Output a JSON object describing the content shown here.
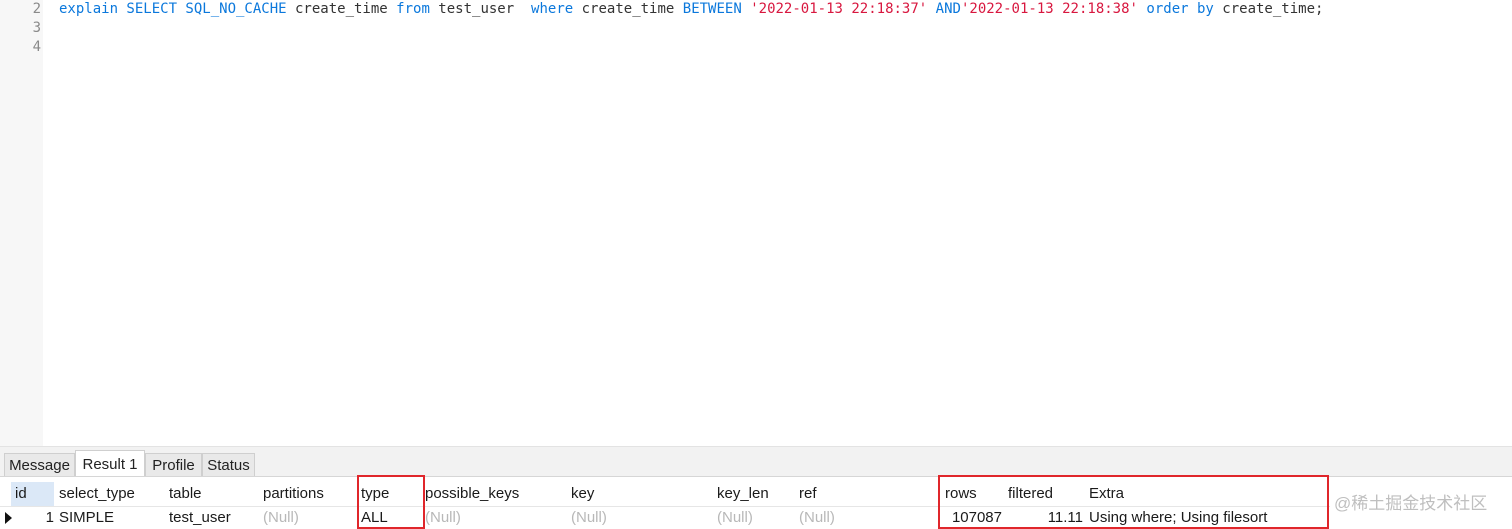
{
  "editor": {
    "line_numbers": [
      "2",
      "3",
      "4"
    ],
    "line2": {
      "t1": "explain SELECT SQL_NO_CACHE",
      "t2": " create_time ",
      "t3": "from",
      "t4": " test_user  ",
      "t5": "where",
      "t6": " create_time ",
      "t7": "BETWEEN",
      "t8": " ",
      "t9": "'2022-01-13 22:18:37'",
      "t10": " ",
      "t11": "AND",
      "t12": "'2022-01-13 22:18:38'",
      "t13": " ",
      "t14": "order by",
      "t15": " create_time;"
    }
  },
  "tabs": [
    {
      "label": "Message",
      "active": false
    },
    {
      "label": "Result 1",
      "active": true
    },
    {
      "label": "Profile",
      "active": false
    },
    {
      "label": "Status",
      "active": false
    }
  ],
  "result": {
    "columns": [
      "id",
      "select_type",
      "table",
      "partitions",
      "type",
      "possible_keys",
      "key",
      "key_len",
      "ref",
      "rows",
      "filtered",
      "Extra"
    ],
    "row": {
      "id": "1",
      "select_type": "SIMPLE",
      "table": "test_user",
      "partitions": "(Null)",
      "type": "ALL",
      "possible_keys": "(Null)",
      "key": "(Null)",
      "key_len": "(Null)",
      "ref": "(Null)",
      "rows": "107087",
      "filtered": "11.11",
      "Extra": "Using where; Using filesort"
    }
  },
  "watermark": "@稀土掘金技术社区",
  "colors": {
    "keyword": "#0b78dc",
    "string": "#d8173f",
    "highlight": "#e0262b"
  }
}
